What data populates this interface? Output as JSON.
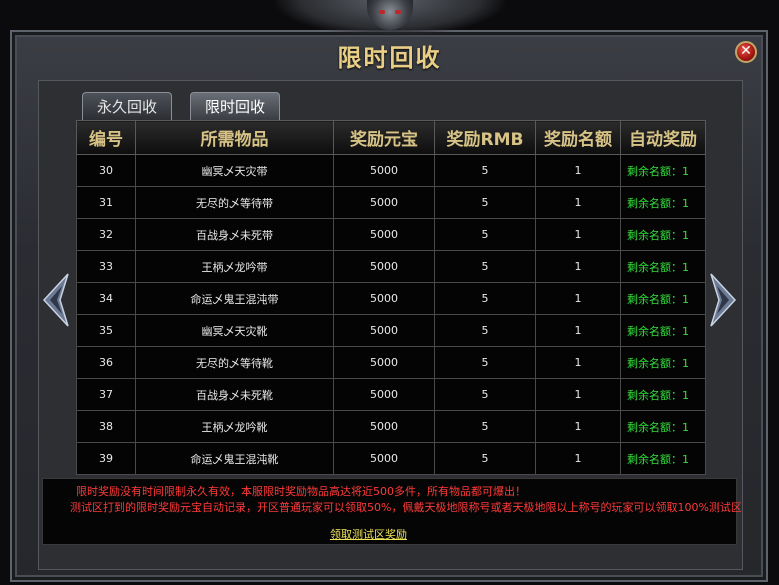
{
  "window": {
    "title": "限时回收",
    "close_label": "✕"
  },
  "tabs": [
    {
      "label": "永久回收",
      "active": false
    },
    {
      "label": "限时回收",
      "active": true
    }
  ],
  "table": {
    "headers": [
      "编号",
      "所需物品",
      "奖励元宝",
      "奖励RMB",
      "奖励名额",
      "自动奖励"
    ],
    "rows": [
      [
        "30",
        "幽冥乄天灾带",
        "5000",
        "5",
        "1",
        "剩余名额：1"
      ],
      [
        "31",
        "无尽的乄等待带",
        "5000",
        "5",
        "1",
        "剩余名额：1"
      ],
      [
        "32",
        "百战身乄未死带",
        "5000",
        "5",
        "1",
        "剩余名额：1"
      ],
      [
        "33",
        "王柄乄龙吟带",
        "5000",
        "5",
        "1",
        "剩余名额：1"
      ],
      [
        "34",
        "命运乄鬼王混沌带",
        "5000",
        "5",
        "1",
        "剩余名额：1"
      ],
      [
        "35",
        "幽冥乄天灾靴",
        "5000",
        "5",
        "1",
        "剩余名额：1"
      ],
      [
        "36",
        "无尽的乄等待靴",
        "5000",
        "5",
        "1",
        "剩余名额：1"
      ],
      [
        "37",
        "百战身乄未死靴",
        "5000",
        "5",
        "1",
        "剩余名额：1"
      ],
      [
        "38",
        "王柄乄龙吟靴",
        "5000",
        "5",
        "1",
        "剩余名额：1"
      ],
      [
        "39",
        "命运乄鬼王混沌靴",
        "5000",
        "5",
        "1",
        "剩余名额：1"
      ]
    ]
  },
  "notice": {
    "line1": "限时奖励没有时间限制永久有效，本服限时奖励物品高达将近500多件，所有物品都可爆出！",
    "line2": "测试区打到的限时奖励元宝自动记录，开区普通玩家可以领取50%，佩戴天极地限称号或者天极地限以上称号的玩家可以领取100%测试区",
    "link": "领取测试区奖励"
  },
  "colors": {
    "title_gold": "#e9cf86",
    "remaining_green": "#34e03a",
    "notice_red": "#ff3a3a",
    "link_yellow": "#f2e55a"
  },
  "icons": {
    "prev": "left-arrow-icon",
    "next": "right-arrow-icon",
    "close": "close-icon"
  }
}
